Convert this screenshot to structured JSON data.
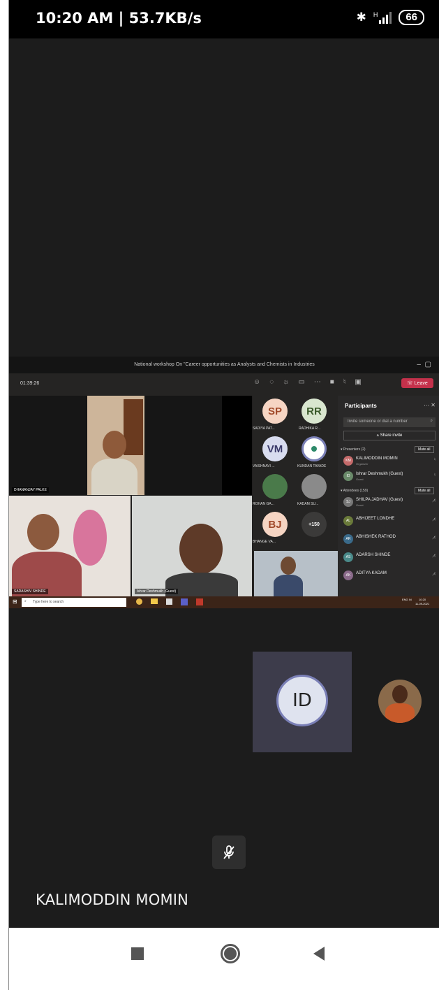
{
  "status_bar": {
    "time_speed": "10:20 AM | 53.7KB/s",
    "network": "H",
    "battery": "66"
  },
  "shared_screen": {
    "window_title": "National workshop On \"Career opportunities as Analysts and Chemists in Industries",
    "meeting_timer": "01:39:26",
    "leave_label": "Leave",
    "video_tiles": [
      {
        "name": "DHANANJAY PALKE"
      },
      {
        "name": "SADASHIV SHINDE"
      },
      {
        "name": "Ishrar Deshmukh (Guest)"
      }
    ],
    "avatar_grid": [
      {
        "initials": "SP",
        "label": "SADIYA PAT...",
        "color": "#f6d5c3"
      },
      {
        "initials": "RR",
        "label": "RADHIKA R...",
        "color": "#d9e6cf"
      },
      {
        "initials": "VM",
        "label": "VAISHNAVI ...",
        "color": "#d8dcef"
      },
      {
        "initials": "",
        "label": "KUNDAN TAVADE",
        "color": "#ffffff"
      },
      {
        "initials": "",
        "label": "ROHAN GA...",
        "color": "#4a7a4a"
      },
      {
        "initials": "",
        "label": "KADAM SU...",
        "color": "#555555"
      },
      {
        "initials": "BJ",
        "label": "BHANGE VA...",
        "color": "#f6d5c3"
      },
      {
        "initials": "+150",
        "label": "",
        "color": "#3b3a39"
      }
    ],
    "participants_panel": {
      "title": "Participants",
      "invite_placeholder": "Invite someone or dial a number",
      "share_invite": "Share invite",
      "presenters_header": "Presenters (2)",
      "attendees_header": "Attendees (159)",
      "mute_all": "Mute all",
      "presenters": [
        {
          "initials": "KM",
          "name": "KALIMODDIN MOMIN",
          "role": "Organizer",
          "color": "#c46a6a"
        },
        {
          "initials": "ID",
          "name": "Ishrar Deshmukh (Guest)",
          "role": "Guest",
          "color": "#6a8a6a"
        }
      ],
      "attendees": [
        {
          "initials": "SJ",
          "name": "SHILPA JADHAV (Guest)",
          "role": "Guest",
          "color": "#777777"
        },
        {
          "initials": "AL",
          "name": "ABHIJEET LONDHE",
          "role": "",
          "color": "#6a7a3a"
        },
        {
          "initials": "AR",
          "name": "ABHISHEK RATHOD",
          "role": "",
          "color": "#3a6a8a"
        },
        {
          "initials": "AS",
          "name": "ADARSH SHINDE",
          "role": "",
          "color": "#4a8a8a"
        },
        {
          "initials": "AK",
          "name": "ADITYA KADAM",
          "role": "",
          "color": "#8a6a8a"
        }
      ]
    },
    "taskbar": {
      "search_placeholder": "Type here to search",
      "lang": "ENG IN",
      "clock_time": "10:20",
      "clock_date": "11-09-2021"
    }
  },
  "participant_tiles": [
    {
      "initials": "ID"
    }
  ],
  "active_speaker": "KALIMODDIN MOMIN"
}
